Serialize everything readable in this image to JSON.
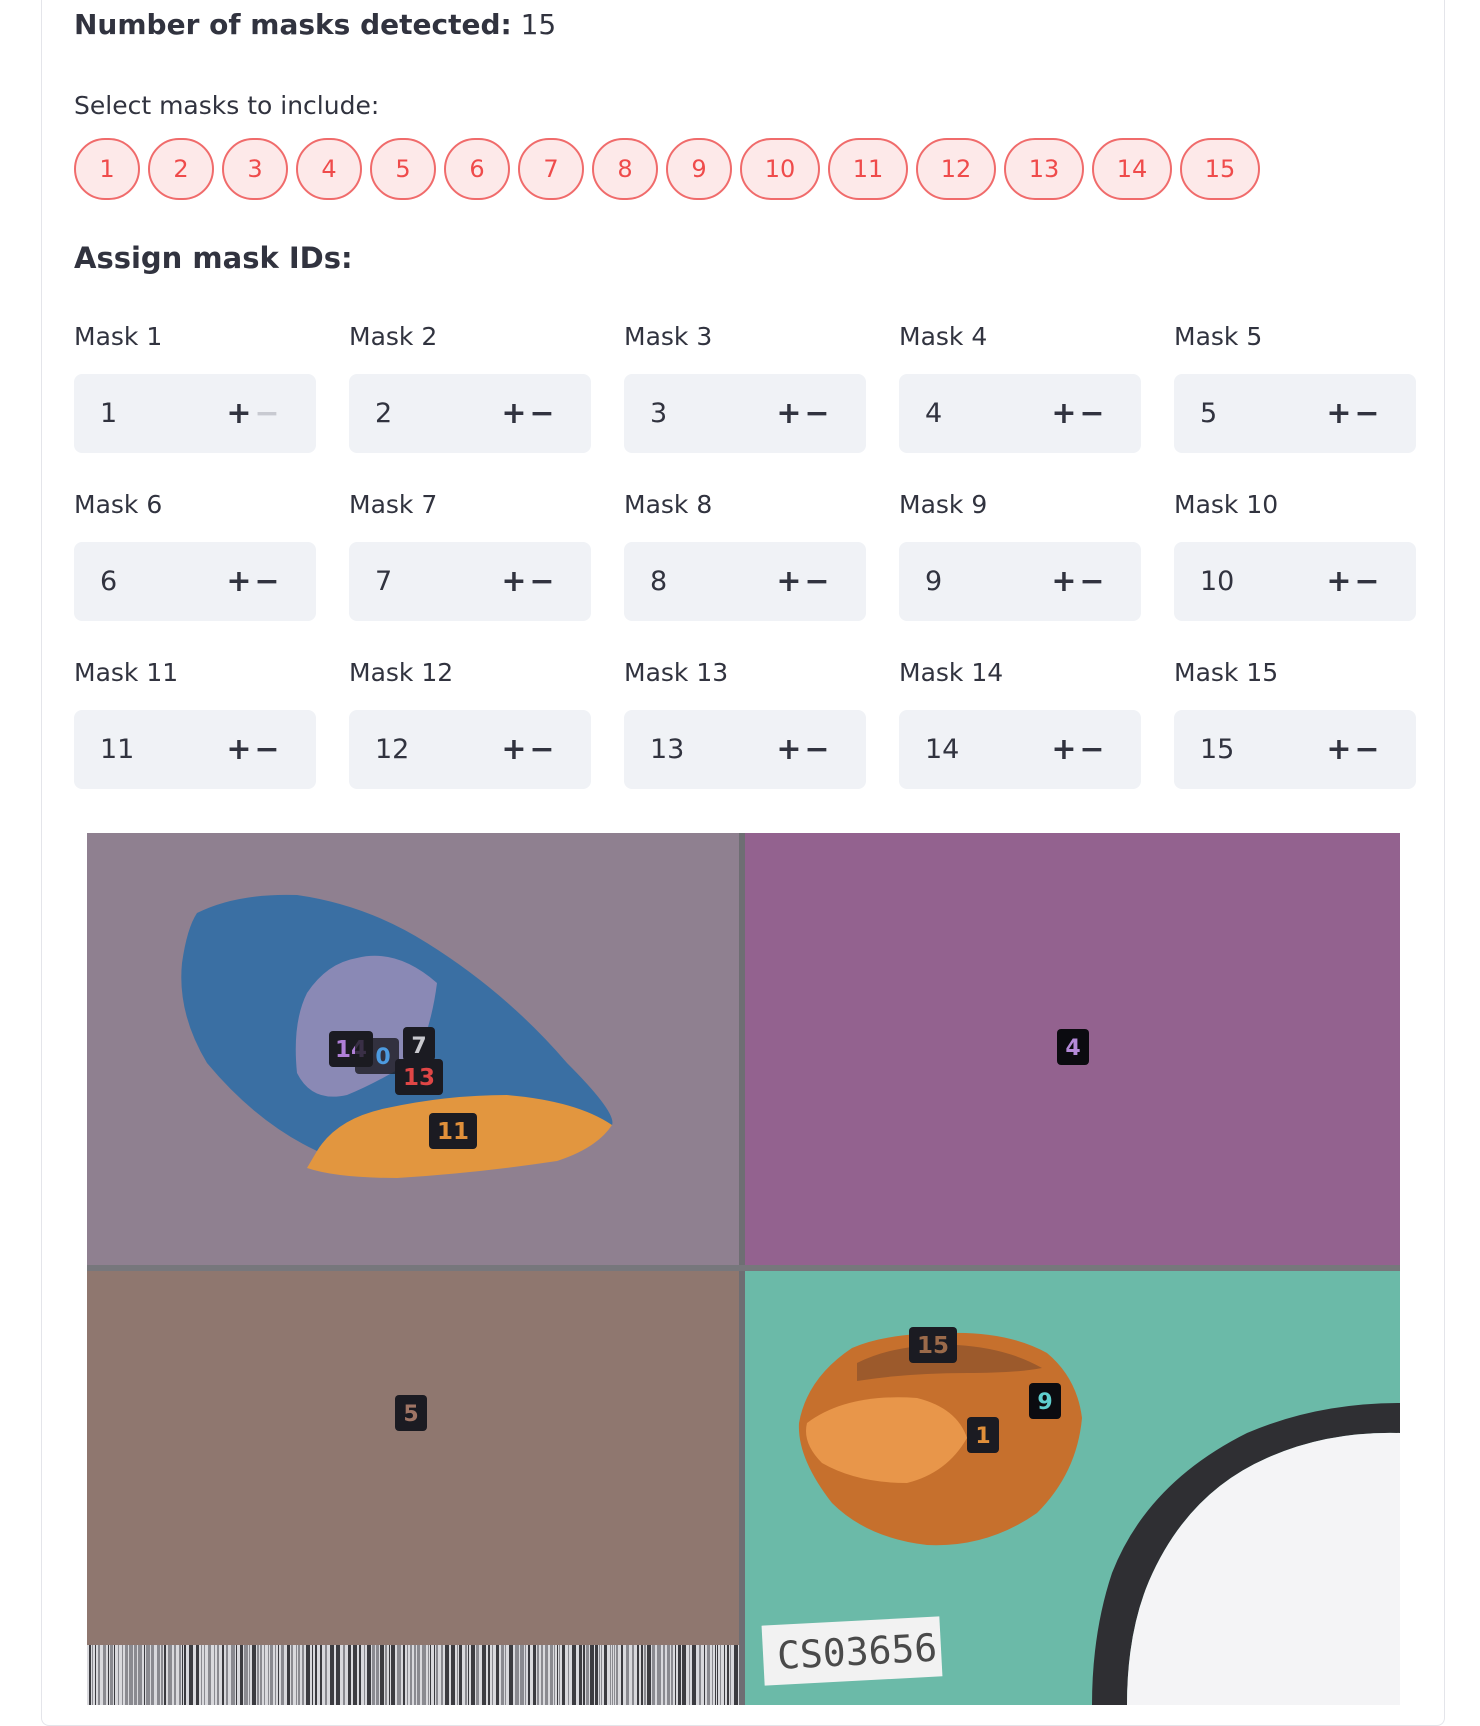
{
  "summary": {
    "label": "Number of masks detected:",
    "value": "15"
  },
  "select": {
    "label": "Select masks to include:",
    "pills": [
      "1",
      "2",
      "3",
      "4",
      "5",
      "6",
      "7",
      "8",
      "9",
      "10",
      "11",
      "12",
      "13",
      "14",
      "15"
    ]
  },
  "assign": {
    "title": "Assign mask IDs:",
    "fields": [
      {
        "label": "Mask 1",
        "value": "1"
      },
      {
        "label": "Mask 2",
        "value": "2"
      },
      {
        "label": "Mask 3",
        "value": "3"
      },
      {
        "label": "Mask 4",
        "value": "4"
      },
      {
        "label": "Mask 5",
        "value": "5"
      },
      {
        "label": "Mask 6",
        "value": "6"
      },
      {
        "label": "Mask 7",
        "value": "7"
      },
      {
        "label": "Mask 8",
        "value": "8"
      },
      {
        "label": "Mask 9",
        "value": "9"
      },
      {
        "label": "Mask 10",
        "value": "10"
      },
      {
        "label": "Mask 11",
        "value": "11"
      },
      {
        "label": "Mask 12",
        "value": "12"
      },
      {
        "label": "Mask 13",
        "value": "13"
      },
      {
        "label": "Mask 14",
        "value": "14"
      },
      {
        "label": "Mask 15",
        "value": "15"
      }
    ],
    "minus_symbol": "−",
    "plus_symbol": "+"
  },
  "image": {
    "mask_labels": [
      "14",
      "0",
      "7",
      "13",
      "11",
      "4",
      "5",
      "15",
      "9",
      "1"
    ],
    "specimen_label": "CS03656",
    "colors": {
      "pill_border": "#f06b6b",
      "pill_text": "#ef4b4b",
      "quad_top_left": "#8f8090",
      "quad_top_right": "#93628f",
      "quad_bottom_left": "#8f776f",
      "quad_bottom_right": "#6bbaa8"
    }
  }
}
